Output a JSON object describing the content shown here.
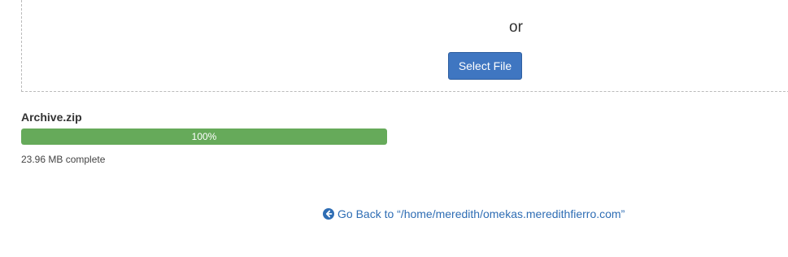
{
  "upload": {
    "or_text": "or",
    "select_file_label": "Select File"
  },
  "file": {
    "name": "Archive.zip",
    "progress_percent": 100,
    "progress_label": "100%",
    "status": "23.96 MB complete"
  },
  "navigation": {
    "go_back_label": "Go Back to “/home/meredith/omekas.meredithfierro.com”",
    "icon": "arrow-circle-left-icon"
  },
  "colors": {
    "primary": "#3f76c1",
    "progress_success": "#66aa5a",
    "link": "#2e6db4"
  }
}
